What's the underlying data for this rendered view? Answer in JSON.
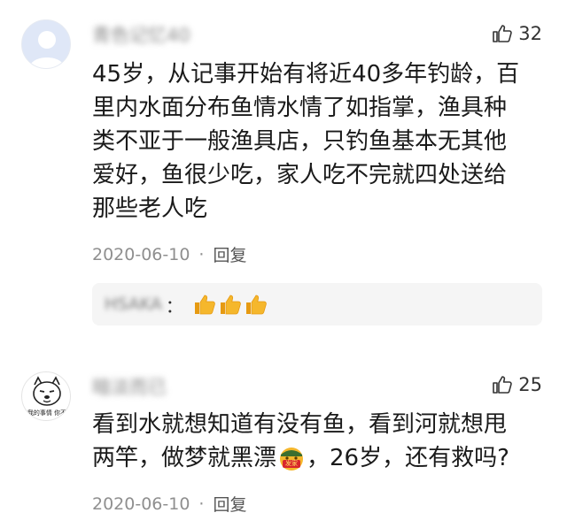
{
  "comments": [
    {
      "username": "青色记忆40",
      "likes": "32",
      "content_lines": [
        "45岁，从记事开始有将近40多年钓龄，百",
        "里内水面分布鱼情水情了如指掌，渔具种",
        "类不亚于一般渔具店，只钓鱼基本无其他",
        "爱好，鱼很少吃，家人吃不完就四处送给",
        "那些老人吃"
      ],
      "date": "2020-06-10",
      "separator": "·",
      "reply_label": "回复",
      "sub_reply": {
        "username": "HSAKA",
        "colon": "："
      }
    },
    {
      "username": "暗淡而已",
      "likes": "25",
      "content_lines": [
        "看到水就想知道有没有鱼，看到河就想甩",
        "两竿，做梦就黑漂",
        "，26岁，还有救吗?"
      ],
      "date": "2020-06-10",
      "separator": "·",
      "reply_label": "回复",
      "avatar_text": "我的事情 你不"
    }
  ],
  "emoji": {
    "thumbs_up": "thumbs-up-emoji",
    "money_face": "money-face-emoji",
    "money_face_label": "发家"
  },
  "colors": {
    "meta_text": "#8f8f8f",
    "reply_bg": "#f5f5f5",
    "emoji_yellow": "#f5b72c"
  }
}
